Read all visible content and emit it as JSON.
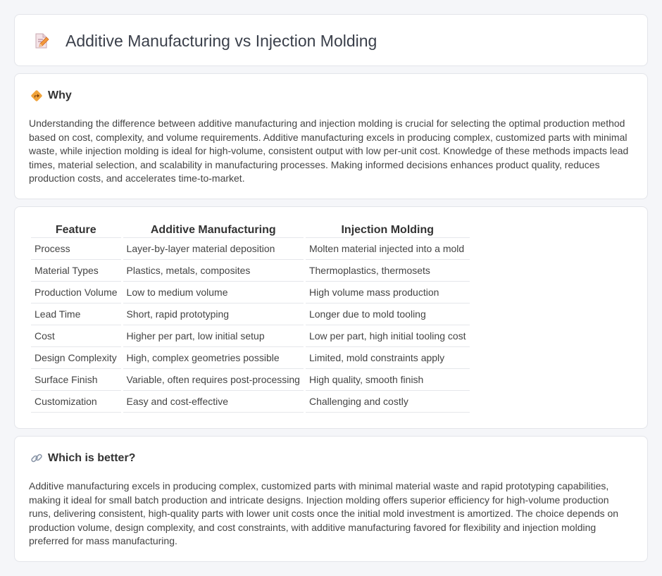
{
  "header": {
    "title": "Additive Manufacturing vs Injection Molding",
    "icon": "document-pencil-icon"
  },
  "why": {
    "heading": "Why",
    "icon": "diamond-direction-icon",
    "text": "Understanding the difference between additive manufacturing and injection molding is crucial for selecting the optimal production method based on cost, complexity, and volume requirements. Additive manufacturing excels in producing complex, customized parts with minimal waste, while injection molding is ideal for high-volume, consistent output with low per-unit cost. Knowledge of these methods impacts lead times, material selection, and scalability in manufacturing processes. Making informed decisions enhances product quality, reduces production costs, and accelerates time-to-market."
  },
  "table": {
    "headers": [
      "Feature",
      "Additive Manufacturing",
      "Injection Molding"
    ],
    "rows": [
      [
        "Process",
        "Layer-by-layer material deposition",
        "Molten material injected into a mold"
      ],
      [
        "Material Types",
        "Plastics, metals, composites",
        "Thermoplastics, thermosets"
      ],
      [
        "Production Volume",
        "Low to medium volume",
        "High volume mass production"
      ],
      [
        "Lead Time",
        "Short, rapid prototyping",
        "Longer due to mold tooling"
      ],
      [
        "Cost",
        "Higher per part, low initial setup",
        "Low per part, high initial tooling cost"
      ],
      [
        "Design Complexity",
        "High, complex geometries possible",
        "Limited, mold constraints apply"
      ],
      [
        "Surface Finish",
        "Variable, often requires post-processing",
        "High quality, smooth finish"
      ],
      [
        "Customization",
        "Easy and cost-effective",
        "Challenging and costly"
      ]
    ]
  },
  "better": {
    "heading": "Which is better?",
    "icon": "link-icon",
    "text": "Additive manufacturing excels in producing complex, customized parts with minimal material waste and rapid prototyping capabilities, making it ideal for small batch production and intricate designs. Injection molding offers superior efficiency for high-volume production runs, delivering consistent, high-quality parts with lower unit costs once the initial mold investment is amortized. The choice depends on production volume, design complexity, and cost constraints, with additive manufacturing favored for flexibility and injection molding preferred for mass manufacturing."
  },
  "colors": {
    "background": "#f5f6f9",
    "card": "#ffffff",
    "border": "#e3e5ea",
    "icon_accent": "#f0a33a"
  }
}
